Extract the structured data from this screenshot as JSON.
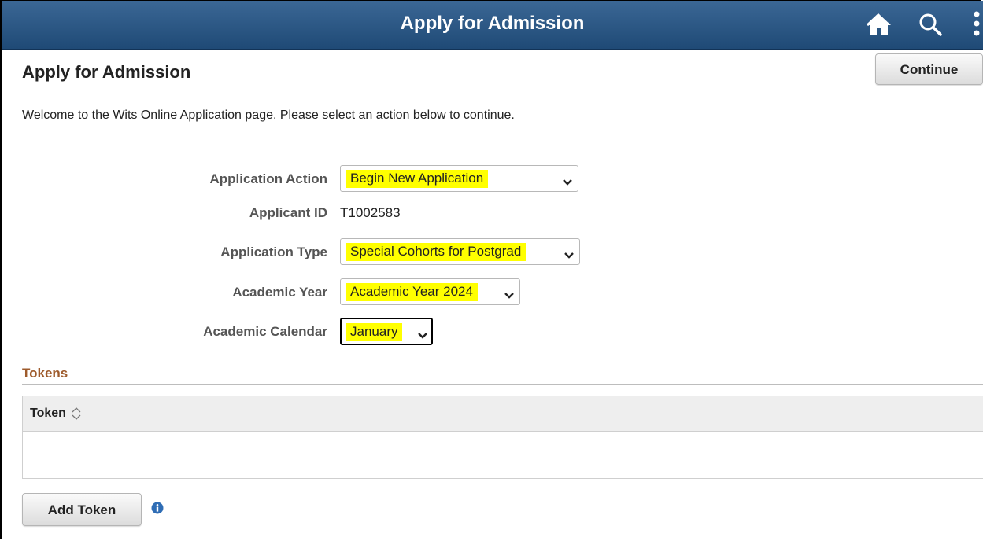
{
  "banner": {
    "title": "Apply for Admission",
    "icons": [
      "home-icon",
      "search-icon",
      "more-icon"
    ]
  },
  "page": {
    "title": "Apply for Admission",
    "continue_label": "Continue"
  },
  "welcome_text": "Welcome to the Wits Online Application page. Please select an action below to continue.",
  "form": {
    "application_action": {
      "label": "Application Action",
      "value": "Begin New Application"
    },
    "applicant_id": {
      "label": "Applicant ID",
      "value": "T1002583"
    },
    "application_type": {
      "label": "Application Type",
      "value": "Special Cohorts for Postgrad"
    },
    "academic_year": {
      "label": "Academic Year",
      "value": "Academic Year 2024"
    },
    "academic_calendar": {
      "label": "Academic Calendar",
      "value": "January"
    }
  },
  "tokens": {
    "heading": "Tokens",
    "columns": [
      "Token"
    ],
    "rows": [],
    "add_label": "Add Token"
  },
  "colors": {
    "banner": "#2c5785",
    "highlight": "#ffff00",
    "section_heading": "#9e5b2c"
  }
}
